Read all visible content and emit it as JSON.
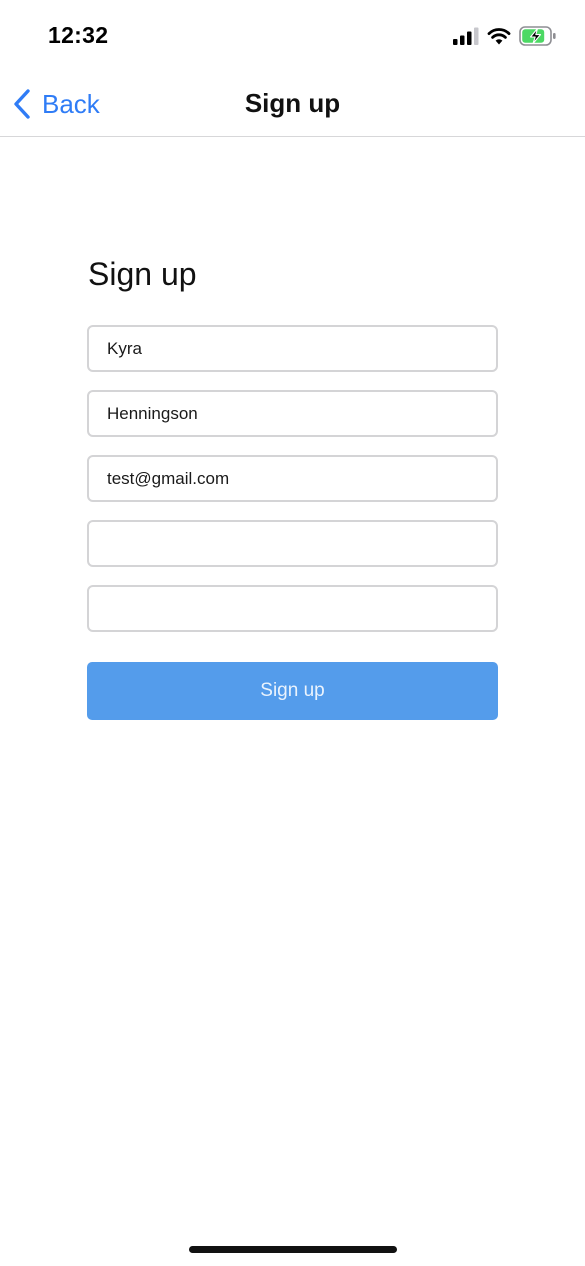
{
  "status_bar": {
    "time": "12:32",
    "icons": [
      "cellular-signal-icon",
      "wifi-icon",
      "battery-charging-icon"
    ],
    "battery_color": "#4cd964"
  },
  "nav": {
    "back_label": "Back",
    "title": "Sign up",
    "accent_color": "#2f7cf6"
  },
  "form": {
    "title": "Sign up",
    "fields": [
      {
        "value": "Kyra"
      },
      {
        "value": "Henningson"
      },
      {
        "value": "test@gmail.com"
      },
      {
        "value": ""
      },
      {
        "value": ""
      }
    ],
    "submit_label": "Sign up",
    "submit_color": "#549ceb"
  }
}
